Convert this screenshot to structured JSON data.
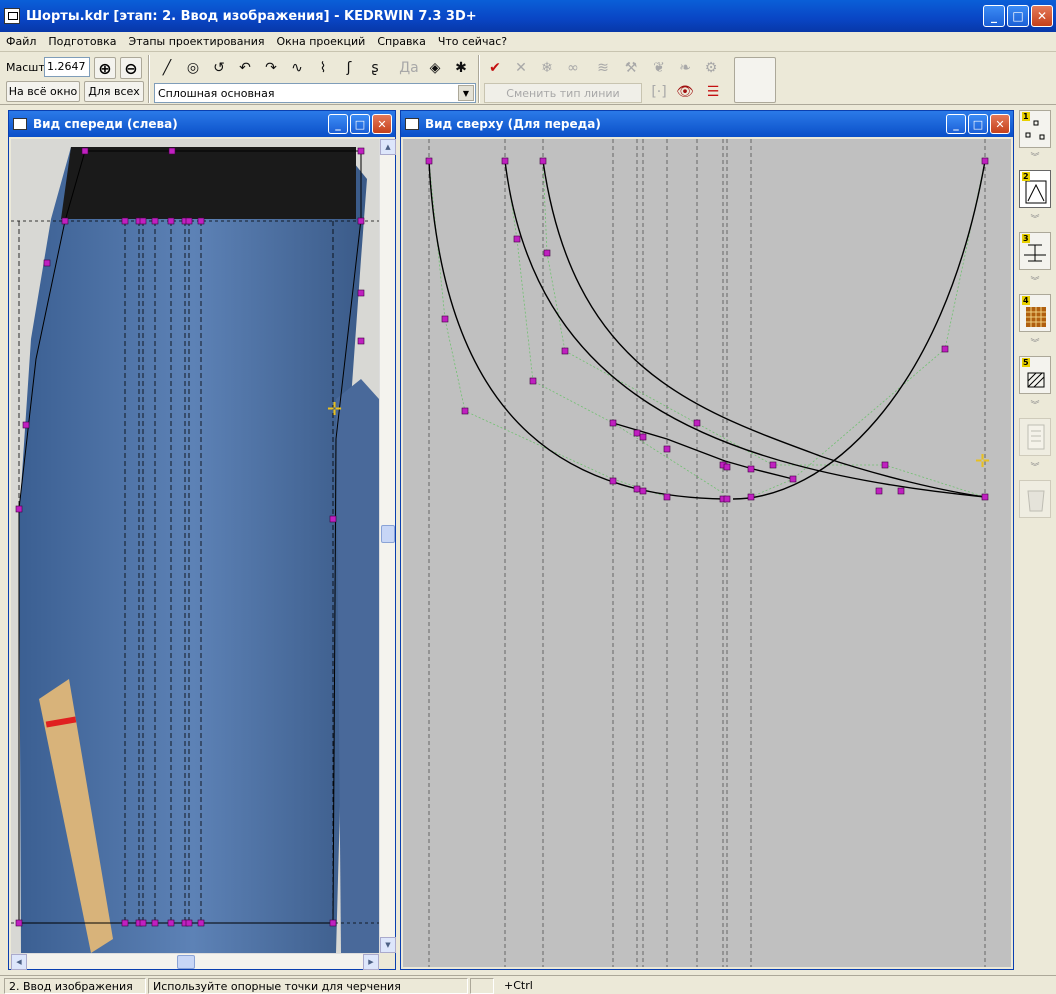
{
  "app": {
    "title": "Шорты.kdr [этап: 2. Ввод изображения] - KEDRWIN 7.3 3D+"
  },
  "window_buttons": {
    "minimize": "_",
    "maximize": "□",
    "close": "✕"
  },
  "menu": [
    "Файл",
    "Подготовка",
    "Этапы проектирования",
    "Окна проекций",
    "Справка",
    "Что сейчас?"
  ],
  "toolbar": {
    "scale_label": "Масшт",
    "scale_value": "1.2647",
    "fit_window": "На всё окно",
    "fit_all": "Для всех",
    "line_type": "Сплошная основная",
    "change_line_type": "Сменить тип линии",
    "tool_icons": [
      "pencil-icon",
      "circle-arc-icon",
      "spiral-icon",
      "rotate-left-icon",
      "rotate-right-icon",
      "curve-tool-icon",
      "node-curve-icon",
      "bezier-icon",
      "hook-icon",
      "text-disabled-icon",
      "diamond-point-icon",
      "star-point-icon"
    ],
    "edit_icons": [
      "checkmark-icon",
      "cross-delete-icon",
      "snowflake-icon",
      "lasso-icon",
      "wave-icon",
      "hammer-icon",
      "ribbon-icon",
      "dots-ribbon-icon",
      "wrench-icon"
    ],
    "extra_icons": [
      "bracket-icon",
      "eye-icon",
      "list-numbered-icon"
    ]
  },
  "front_window": {
    "title": "Вид спереди (слева)"
  },
  "top_window": {
    "title": "Вид сверху (Для переда)"
  },
  "right_panel": [
    {
      "num": "1",
      "icon": "points-icon"
    },
    {
      "num": "2",
      "icon": "triangle-shape-icon"
    },
    {
      "num": "3",
      "icon": "dimension-icon"
    },
    {
      "num": "4",
      "icon": "grid-pattern-icon"
    },
    {
      "num": "5",
      "icon": "hatch-text-icon"
    },
    {
      "num": "",
      "icon": "document-icon"
    },
    {
      "num": "",
      "icon": "mannequin-icon"
    }
  ],
  "status": {
    "stage": "2. Ввод изображения",
    "hint": "Используйте опорные точки для черчения",
    "modifier": "+Ctrl"
  },
  "colors": {
    "titlebar": "#0945c4",
    "canvas_bg": "#c0c0c0",
    "point_marker": "#c020c0",
    "curve": "#000000",
    "guide": "#70c070"
  }
}
